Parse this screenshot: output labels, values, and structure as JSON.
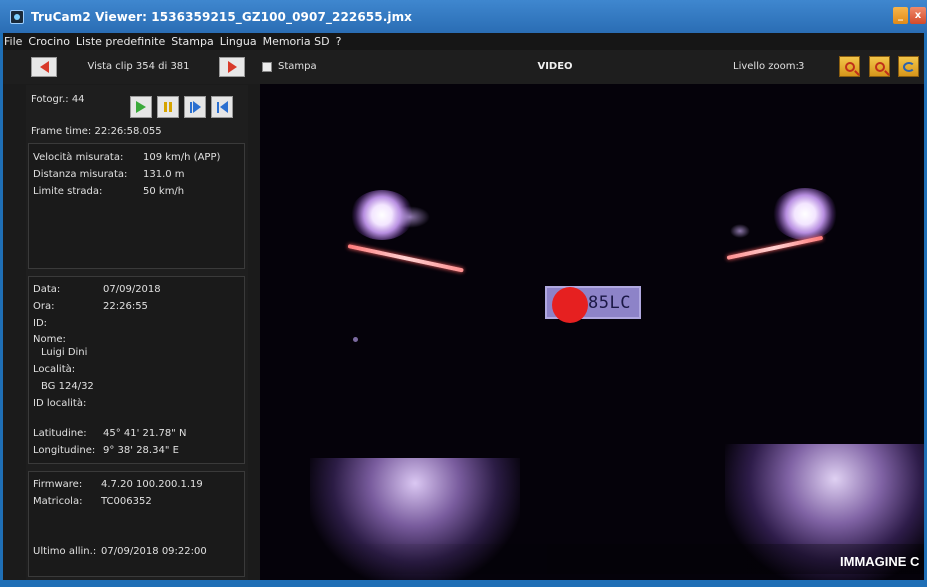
{
  "window": {
    "title": "TruCam2 Viewer:  1536359215_GZ100_0907_222655.jmx",
    "minimize_label": "_",
    "close_label": "x"
  },
  "menu": {
    "items": [
      "File",
      "Crocino",
      "Liste predefinite",
      "Stampa",
      "Lingua",
      "Memoria SD",
      "?"
    ]
  },
  "toolbar": {
    "clip_label": "Vista clip 354 di 381",
    "print_label": "Stampa",
    "print_checked": false,
    "video_label": "VIDEO",
    "zoom_label": "Livello zoom:",
    "zoom_value": "3"
  },
  "left": {
    "photo": "Fotogr.: 44",
    "frame_time": "Frame time:  22:26:58.055",
    "measure": {
      "speed_label": "Velocità misurata:",
      "speed_value": "109 km/h (APP)",
      "distance_label": "Distanza misurata:",
      "distance_value": "131.0 m",
      "limit_label": "Limite strada:",
      "limit_value": "50 km/h"
    },
    "info": {
      "date_label": "Data:",
      "date_value": "07/09/2018",
      "time_label": "Ora:",
      "time_value": "22:26:55",
      "id_label": "ID:",
      "name_label": "Nome:",
      "name_value": "Luigi  Dini",
      "location_label": "Località:",
      "location_value": "BG 124/32",
      "location_id_label": "ID località:",
      "lat_label": "Latitudine:",
      "lat_value": "45° 41' 21.78\" N",
      "lon_label": "Longitudine:",
      "lon_value": "9° 38' 28.34\" E"
    },
    "device": {
      "firmware_label": "Firmware:",
      "firmware_value": "4.7.20  100.200.1.19",
      "serial_label": "Matricola:",
      "serial_value": "TC006352",
      "align_label": "Ultimo allin.:",
      "align_value": "07/09/2018  09:22:00"
    }
  },
  "video": {
    "plate_text": "685LC",
    "watermark": "IMMAGINE C"
  },
  "colors": {
    "titlebar": "#2a6db4",
    "nav_arrow": "#d83a2a",
    "redaction": "#e62020"
  }
}
